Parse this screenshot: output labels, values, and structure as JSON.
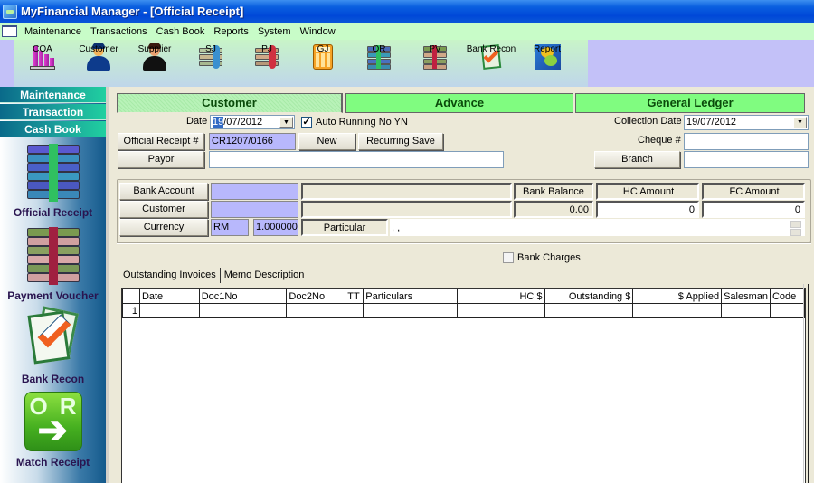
{
  "window": {
    "title": "MyFinancial Manager - [Official Receipt]"
  },
  "menu": {
    "items": [
      "Maintenance",
      "Transactions",
      "Cash Book",
      "Reports",
      "System",
      "Window"
    ]
  },
  "toolbar": {
    "buttons": [
      {
        "label": "COA",
        "icon": "chart-of-accounts-icon"
      },
      {
        "label": "Customer",
        "icon": "customer-icon"
      },
      {
        "label": "Supplier",
        "icon": "supplier-icon"
      },
      {
        "label": "SJ",
        "icon": "sales-journal-icon"
      },
      {
        "label": "PJ",
        "icon": "purchase-journal-icon"
      },
      {
        "label": "GJ",
        "icon": "calculator-icon"
      },
      {
        "label": "OR",
        "icon": "money-stack-icon"
      },
      {
        "label": "PV",
        "icon": "money-stack-red-icon"
      },
      {
        "label": "Bank Recon",
        "icon": "bank-recon-icon"
      },
      {
        "label": "Report",
        "icon": "report-icon"
      }
    ]
  },
  "sidebar": {
    "tabs": [
      "Maintenance",
      "Transaction",
      "Cash Book"
    ],
    "items": [
      {
        "label": "Official Receipt",
        "icon": "money-stack-icon"
      },
      {
        "label": "Payment Voucher",
        "icon": "money-stack-red-icon"
      },
      {
        "label": "Bank Recon",
        "icon": "bank-recon-icon"
      },
      {
        "label": "Match Receipt",
        "icon": "match-receipt-icon"
      }
    ]
  },
  "form": {
    "section_tabs": [
      "Customer",
      "Advance",
      "General Ledger"
    ],
    "date_label": "Date",
    "date_value_selected": "19",
    "date_value_rest": "/07/2012",
    "auto_running_label": "Auto Running No YN",
    "auto_running_checked": true,
    "collection_date_label": "Collection Date",
    "collection_date_value": "19/07/2012",
    "official_receipt_label": "Official Receipt #",
    "official_receipt_value": "CR1207/0166",
    "new_button": "New",
    "recurring_save_button": "Recurring Save",
    "cheque_label": "Cheque #",
    "cheque_value": "",
    "payor_button": "Payor",
    "payor_value": "",
    "branch_button": "Branch",
    "branch_value": "",
    "bank_account_button": "Bank Account",
    "bank_account_code": "",
    "bank_account_name": "",
    "bank_balance_label": "Bank Balance",
    "bank_balance_value": "0.00",
    "hc_amount_label": "HC Amount",
    "hc_amount_value": "0",
    "fc_amount_label": "FC Amount",
    "fc_amount_value": "0",
    "customer_button": "Customer",
    "customer_code": "",
    "customer_name": "",
    "currency_button": "Currency",
    "currency_code": "RM",
    "currency_rate": "1.000000",
    "particular_label": "Particular",
    "particular_value": ", ,",
    "bank_charges_label": "Bank Charges",
    "bank_charges_checked": false
  },
  "detail_tabs": [
    "Outstanding Invoices",
    "Memo Description"
  ],
  "grid": {
    "columns": [
      "",
      "Date",
      "Doc1No",
      "Doc2No",
      "TT",
      "Particulars",
      "HC $",
      "Outstanding $",
      "$ Applied",
      "Salesman",
      "Code"
    ],
    "rows": [
      [
        "1",
        "",
        "",
        "",
        "",
        "",
        "",
        "",
        "",
        "",
        ""
      ]
    ]
  }
}
